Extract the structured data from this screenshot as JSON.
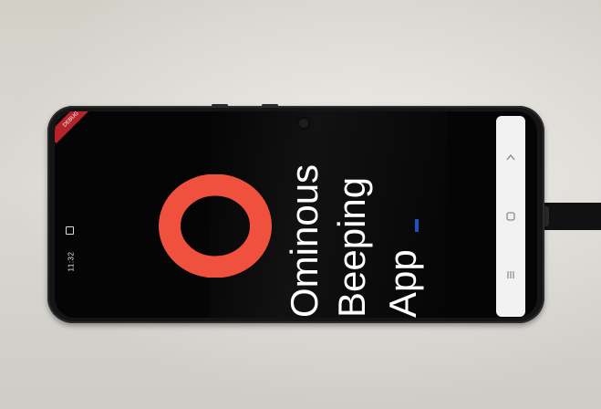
{
  "app": {
    "title_lines": [
      "Ominous",
      "Beeping",
      "App"
    ],
    "logo_color": "#F0503E",
    "background_color": "#050505"
  },
  "status_bar": {
    "time": "11:32"
  },
  "debug_banner": {
    "label": "DEBUG"
  },
  "nav_bar": {
    "back_icon": "chevron-left-icon",
    "home_icon": "home-square-icon",
    "recents_icon": "recents-lines-icon"
  }
}
